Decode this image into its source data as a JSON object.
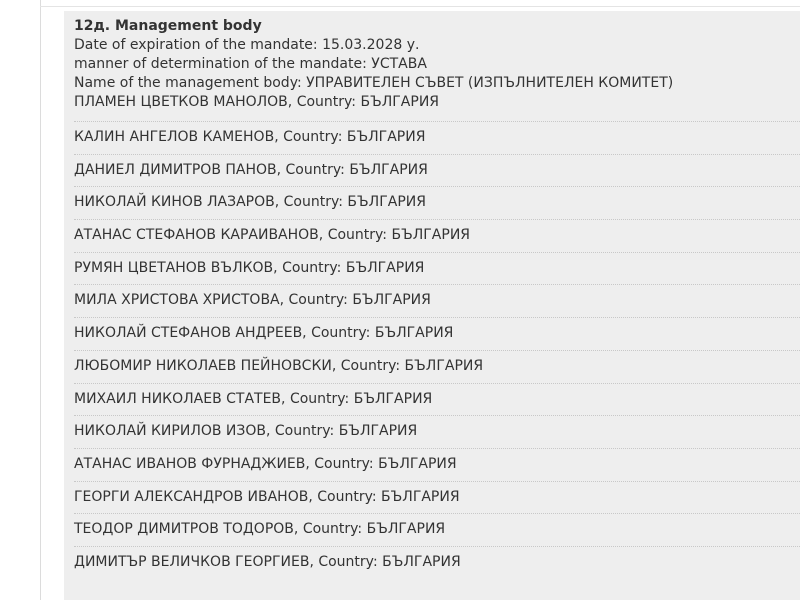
{
  "section": {
    "title": "12д. Management body",
    "expiration_label": "Date of expiration of the mandate:",
    "expiration_value": "15.03.2028 у.",
    "manner_label": "manner of determination of the mandate:",
    "manner_value": "УСТАВА",
    "body_name_label": "Name of the management body:",
    "body_name_value": "УПРАВИТЕЛЕН СЪВЕТ (ИЗПЪЛНИТЕЛЕН КОМИТЕТ)"
  },
  "country_label": "Country:",
  "members": [
    {
      "name": "ПЛАМЕН ЦВЕТКОВ МАНОЛОВ",
      "country": "БЪЛГАРИЯ"
    },
    {
      "name": "КАЛИН АНГЕЛОВ КАМЕНОВ",
      "country": "БЪЛГАРИЯ"
    },
    {
      "name": "ДАНИЕЛ ДИМИТРОВ ПАНОВ",
      "country": "БЪЛГАРИЯ"
    },
    {
      "name": "НИКОЛАЙ КИНОВ ЛАЗАРОВ",
      "country": "БЪЛГАРИЯ"
    },
    {
      "name": "АТАНАС СТЕФАНОВ КАРАИВАНОВ",
      "country": "БЪЛГАРИЯ"
    },
    {
      "name": "РУМЯН ЦВЕТАНОВ ВЪЛКОВ",
      "country": "БЪЛГАРИЯ"
    },
    {
      "name": "МИЛА ХРИСТОВА ХРИСТОВА",
      "country": "БЪЛГАРИЯ"
    },
    {
      "name": "НИКОЛАЙ СТЕФАНОВ АНДРЕЕВ",
      "country": "БЪЛГАРИЯ"
    },
    {
      "name": "ЛЮБОМИР НИКОЛАЕВ ПЕЙНОВСКИ",
      "country": "БЪЛГАРИЯ"
    },
    {
      "name": "МИХАИЛ НИКОЛАЕВ СТАТЕВ",
      "country": "БЪЛГАРИЯ"
    },
    {
      "name": "НИКОЛАЙ КИРИЛОВ ИЗОВ",
      "country": "БЪЛГАРИЯ"
    },
    {
      "name": "АТАНАС ИВАНОВ ФУРНАДЖИЕВ",
      "country": "БЪЛГАРИЯ"
    },
    {
      "name": "ГЕОРГИ АЛЕКСАНДРОВ ИВАНОВ",
      "country": "БЪЛГАРИЯ"
    },
    {
      "name": "ТЕОДОР ДИМИТРОВ ТОДОРОВ",
      "country": "БЪЛГАРИЯ"
    },
    {
      "name": "ДИМИТЪР ВЕЛИЧКОВ ГЕОРГИЕВ",
      "country": "БЪЛГАРИЯ"
    }
  ]
}
